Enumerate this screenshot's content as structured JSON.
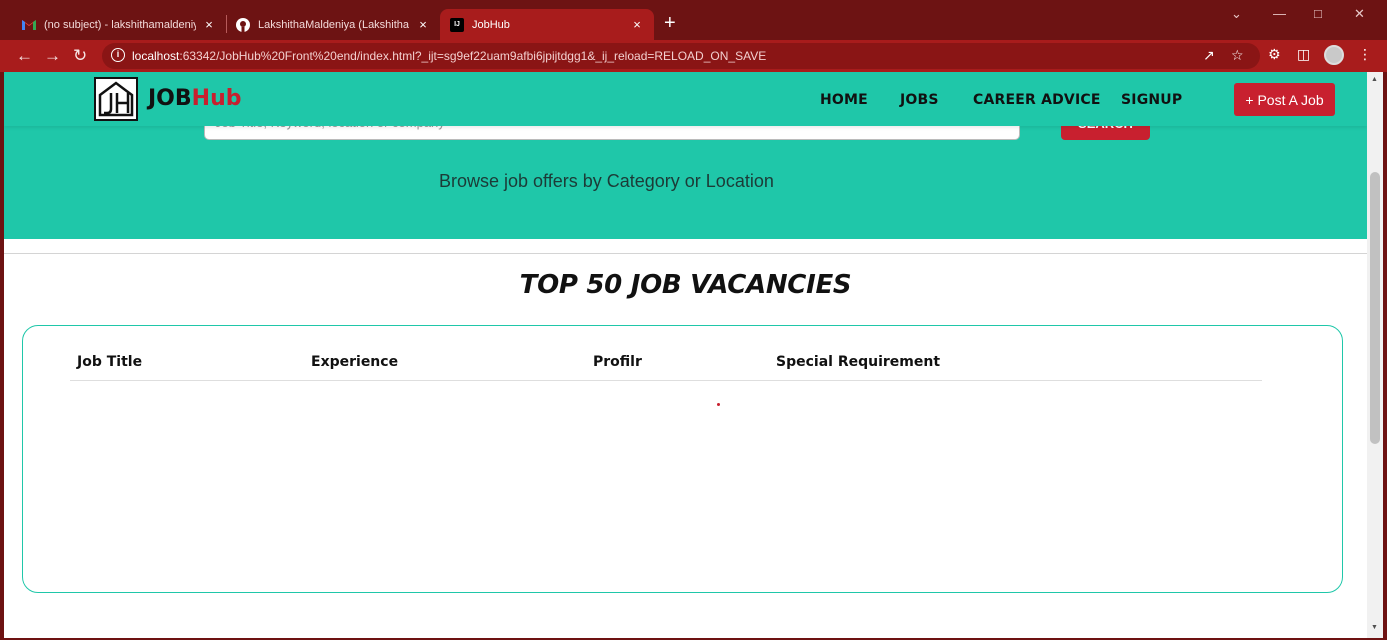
{
  "browser": {
    "tabs": [
      {
        "title": "(no subject) - lakshithamaldeniya",
        "icon": "gmail-icon"
      },
      {
        "title": "LakshithaMaldeniya (Lakshitha M",
        "icon": "github-icon"
      },
      {
        "title": "JobHub",
        "icon": "intellij-icon"
      }
    ],
    "close_glyph": "×",
    "new_tab_glyph": "+",
    "url_host": "localhost",
    "url_rest": ":63342/JobHub%20Front%20end/index.html?_ijt=sg9ef22uam9afbi6jpijtdgg1&_ij_reload=RELOAD_ON_SAVE",
    "info_glyph": "i",
    "colors": {
      "frame": "#6d1313",
      "active_tab": "#a81c1c"
    }
  },
  "site": {
    "brand_part1": "JOB",
    "brand_part2": "Hub",
    "nav": [
      "HOME",
      "JOBS",
      "CAREER ADVICE",
      "SIGNUP"
    ],
    "post_button": "+ Post A Job",
    "search_placeholder": "Job Title, Keyword, location or company",
    "search_button": "SEARCH",
    "browse_text": "Browse job offers by Category or Location",
    "section_title": "TOP 50 JOB VACANCIES",
    "table_headers": [
      "Job Title",
      "Experience",
      "Profilr",
      "Special Requirement"
    ],
    "colors": {
      "teal": "#1fc7a9",
      "accent_red": "#c8202f"
    }
  }
}
